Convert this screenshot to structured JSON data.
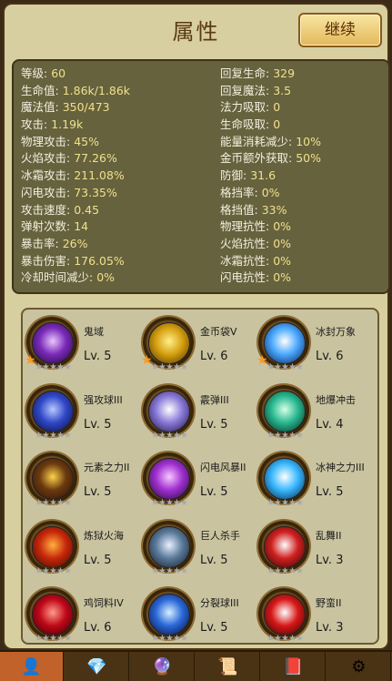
{
  "header": {
    "title": "属性",
    "continue_label": "继续"
  },
  "stats": {
    "left": [
      {
        "label": "等级: ",
        "value": "60"
      },
      {
        "label": "生命值: ",
        "value": "1.86k/1.86k"
      },
      {
        "label": "魔法值: ",
        "value": "350/473"
      },
      {
        "label": "攻击: ",
        "value": "1.19k"
      },
      {
        "label": "物理攻击: ",
        "value": "45%"
      },
      {
        "label": "火焰攻击: ",
        "value": "77.26%"
      },
      {
        "label": "冰霜攻击: ",
        "value": "211.08%"
      },
      {
        "label": "闪电攻击: ",
        "value": "73.35%"
      },
      {
        "label": "攻击速度: ",
        "value": "0.45"
      },
      {
        "label": "弹射次数: ",
        "value": "14"
      },
      {
        "label": "暴击率: ",
        "value": "26%"
      },
      {
        "label": "暴击伤害: ",
        "value": "176.05%"
      },
      {
        "label": "冷却时间减少: ",
        "value": "0%"
      }
    ],
    "right": [
      {
        "label": "回复生命: ",
        "value": "329"
      },
      {
        "label": "回复魔法: ",
        "value": "3.5"
      },
      {
        "label": "法力吸取: ",
        "value": "0"
      },
      {
        "label": "生命吸取: ",
        "value": "0"
      },
      {
        "label": "能量消耗减少: ",
        "value": "10%"
      },
      {
        "label": "金币额外获取: ",
        "value": "50%"
      },
      {
        "label": "防御: ",
        "value": "31.6"
      },
      {
        "label": "格挡率: ",
        "value": "0%"
      },
      {
        "label": "格挡值: ",
        "value": "33%"
      },
      {
        "label": "物理抗性: ",
        "value": "0%"
      },
      {
        "label": "火焰抗性: ",
        "value": "0%"
      },
      {
        "label": "冰霜抗性: ",
        "value": "0%"
      },
      {
        "label": "闪电抗性: ",
        "value": "0%"
      }
    ]
  },
  "skills": [
    {
      "name": "鬼域",
      "level": "Lv. 5",
      "icon": "ghost-domain-icon",
      "colors": [
        "#e9c6ff",
        "#7a2ab8",
        "#1a0830"
      ],
      "badge": true
    },
    {
      "name": "金币袋V",
      "level": "Lv. 6",
      "icon": "coin-bag-icon",
      "colors": [
        "#fff08a",
        "#d6a010",
        "#4a3004"
      ],
      "badge": true
    },
    {
      "name": "冰封万象",
      "level": "Lv. 6",
      "icon": "ice-seal-icon",
      "colors": [
        "#ffffff",
        "#4aa8ff",
        "#0a1a4a"
      ],
      "badge": true
    },
    {
      "name": "强攻球III",
      "level": "Lv. 5",
      "icon": "power-orb-icon",
      "colors": [
        "#b8c8ff",
        "#3048c8",
        "#0a0a30"
      ],
      "badge": false
    },
    {
      "name": "霰弹III",
      "level": "Lv. 5",
      "icon": "buckshot-icon",
      "colors": [
        "#ffffff",
        "#8a7ad8",
        "#1a1040"
      ],
      "badge": false
    },
    {
      "name": "地爆冲击",
      "level": "Lv. 4",
      "icon": "ground-blast-icon",
      "colors": [
        "#d8ffe8",
        "#28b890",
        "#04241a"
      ],
      "badge": false
    },
    {
      "name": "元素之力II",
      "level": "Lv. 5",
      "icon": "element-power-icon",
      "colors": [
        "#ffd24a",
        "#6a3a10",
        "#2a1004"
      ],
      "badge": false
    },
    {
      "name": "闪电风暴II",
      "level": "Lv. 5",
      "icon": "lightning-storm-icon",
      "colors": [
        "#f8c8ff",
        "#a030d0",
        "#200830"
      ],
      "badge": false
    },
    {
      "name": "冰神之力III",
      "level": "Lv. 5",
      "icon": "ice-god-icon",
      "colors": [
        "#ffffff",
        "#38b8ff",
        "#062040"
      ],
      "badge": false
    },
    {
      "name": "炼狱火海",
      "level": "Lv. 5",
      "icon": "inferno-icon",
      "colors": [
        "#ffb040",
        "#c8280a",
        "#3a0800"
      ],
      "badge": false
    },
    {
      "name": "巨人杀手",
      "level": "Lv. 5",
      "icon": "giant-slayer-icon",
      "colors": [
        "#e8f0ff",
        "#5a7a9a",
        "#101820"
      ],
      "badge": false
    },
    {
      "name": "乱舞II",
      "level": "Lv. 3",
      "icon": "wild-dance-icon",
      "colors": [
        "#ffffff",
        "#d02020",
        "#300404"
      ],
      "badge": false
    },
    {
      "name": "鸡饲料IV",
      "level": "Lv. 6",
      "icon": "chicken-feed-icon",
      "colors": [
        "#ff9a8a",
        "#c00818",
        "#300004"
      ],
      "badge": false
    },
    {
      "name": "分裂球III",
      "level": "Lv. 5",
      "icon": "split-orb-icon",
      "colors": [
        "#d8f0ff",
        "#2a68d8",
        "#060a30"
      ],
      "badge": false
    },
    {
      "name": "野蛮II",
      "level": "Lv. 3",
      "icon": "savage-icon",
      "colors": [
        "#ffffff",
        "#d81818",
        "#300404"
      ],
      "badge": false
    }
  ],
  "tabs": [
    {
      "icon": "character-icon",
      "glyph": "👤",
      "active": true
    },
    {
      "icon": "blue-gem-icon",
      "glyph": "💎",
      "active": false
    },
    {
      "icon": "purple-gem-icon",
      "glyph": "🔮",
      "active": false
    },
    {
      "icon": "scroll-icon",
      "glyph": "📜",
      "active": false
    },
    {
      "icon": "spellbook-icon",
      "glyph": "📕",
      "active": false
    },
    {
      "icon": "cog-icon",
      "glyph": "⚙",
      "active": false
    }
  ]
}
